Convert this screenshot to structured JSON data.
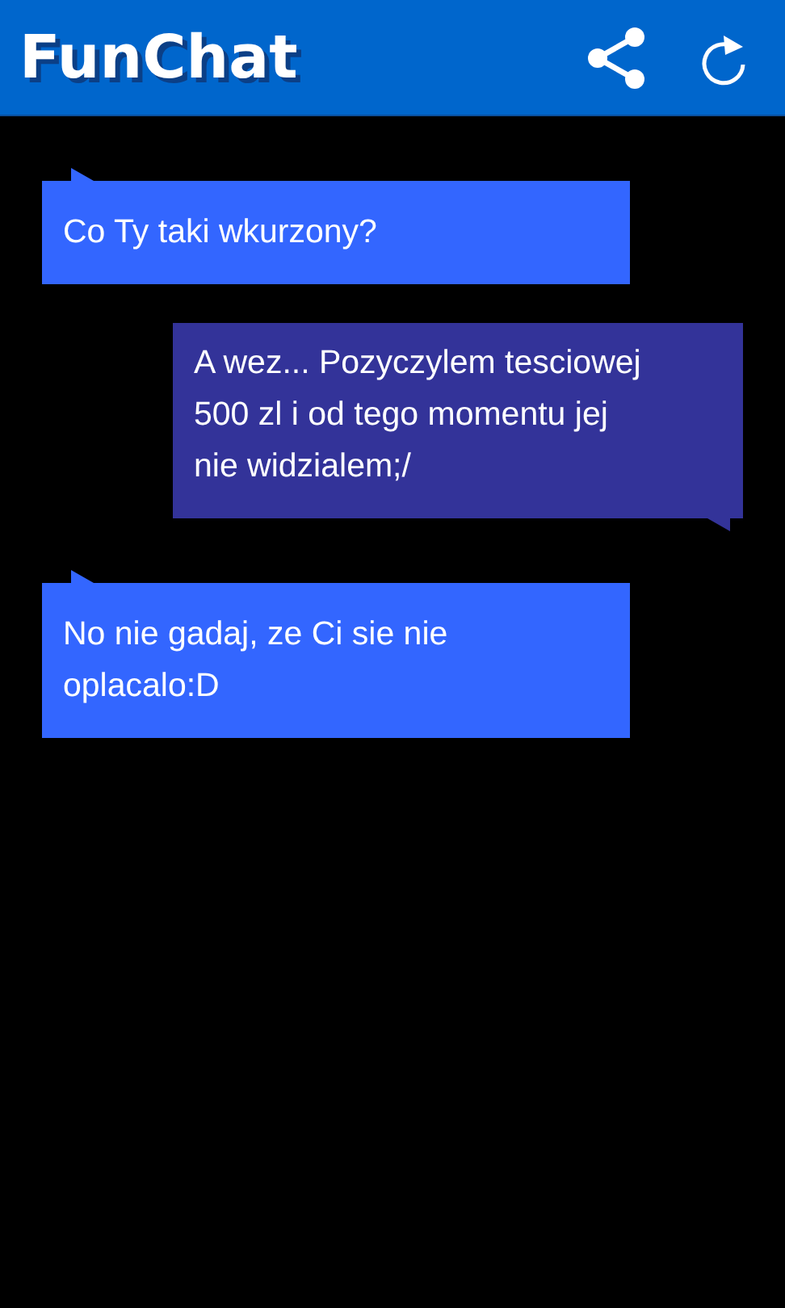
{
  "app_bar": {
    "title": "FunChat"
  },
  "messages": [
    {
      "kind": "incoming",
      "text": "Co Ty taki wkurzony?"
    },
    {
      "kind": "outgoing",
      "text": "A wez... Pozyczylem tesciowej\n500 zl i od tego momentu jej\nnie widzialem;/"
    },
    {
      "kind": "incoming",
      "text": "No nie gadaj, ze Ci sie nie\noplacalo:D"
    }
  ]
}
